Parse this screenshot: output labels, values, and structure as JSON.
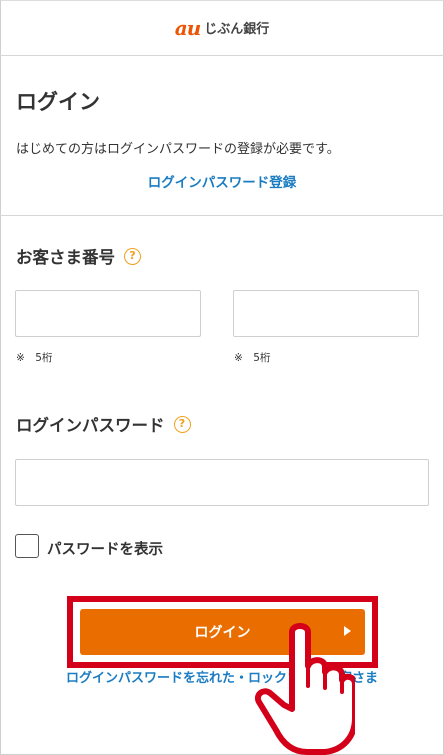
{
  "header": {
    "brand_mark": "au",
    "brand_name": "じぶん銀行"
  },
  "page": {
    "title": "ログイン",
    "notice": "はじめての方はログインパスワードの登録が必要です。",
    "register_link": "ログインパスワード登録"
  },
  "customer_number": {
    "label": "お客さま番号",
    "help_icon": "question-circle-icon",
    "field1_value": "",
    "field1_hint": "※　5桁",
    "field2_value": "",
    "field2_hint": "※　5桁"
  },
  "password": {
    "label": "ログインパスワード",
    "help_icon": "question-circle-icon",
    "value": "",
    "show_password_label": "パスワードを表示",
    "show_password_checked": false
  },
  "actions": {
    "login_label": "ログイン",
    "forgot_link": "ログインパスワードを忘れた・ロックされたお客さま"
  },
  "colors": {
    "brand": "#eb5505",
    "button": "#ea6d00",
    "link": "#1a7cc2",
    "highlight": "#d4001a",
    "help": "#f0a020"
  }
}
